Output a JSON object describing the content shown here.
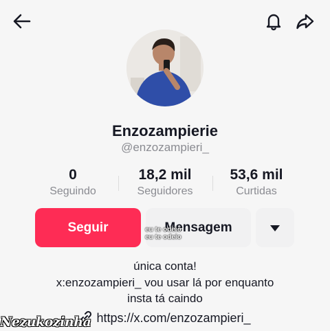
{
  "profile": {
    "display_name": "Enzozampierie",
    "handle": "@enzozampieri_"
  },
  "stats": [
    {
      "value": "0",
      "label": "Seguindo"
    },
    {
      "value": "18,2 mil",
      "label": "Seguidores"
    },
    {
      "value": "53,6 mil",
      "label": "Curtidas"
    }
  ],
  "actions": {
    "follow_label": "Seguir",
    "message_label": "Mensagem"
  },
  "sticker": {
    "line1": "eu te odeio",
    "line2": "eu te odeio"
  },
  "bio": {
    "line1": "única conta!",
    "line2": "x:enzozampieri_ vou usar lá por enquanto",
    "line3": "insta tá caindo"
  },
  "link": {
    "text": "https://x.com/enzozampieri_"
  },
  "watermark": "Nezukozinha",
  "colors": {
    "follow_button": "#fe2c55",
    "secondary_button": "#f1f1f2",
    "muted_text": "#8a8b91"
  },
  "icons": [
    "back-arrow-icon",
    "bell-icon",
    "share-icon",
    "chevron-down-icon",
    "link-icon"
  ]
}
